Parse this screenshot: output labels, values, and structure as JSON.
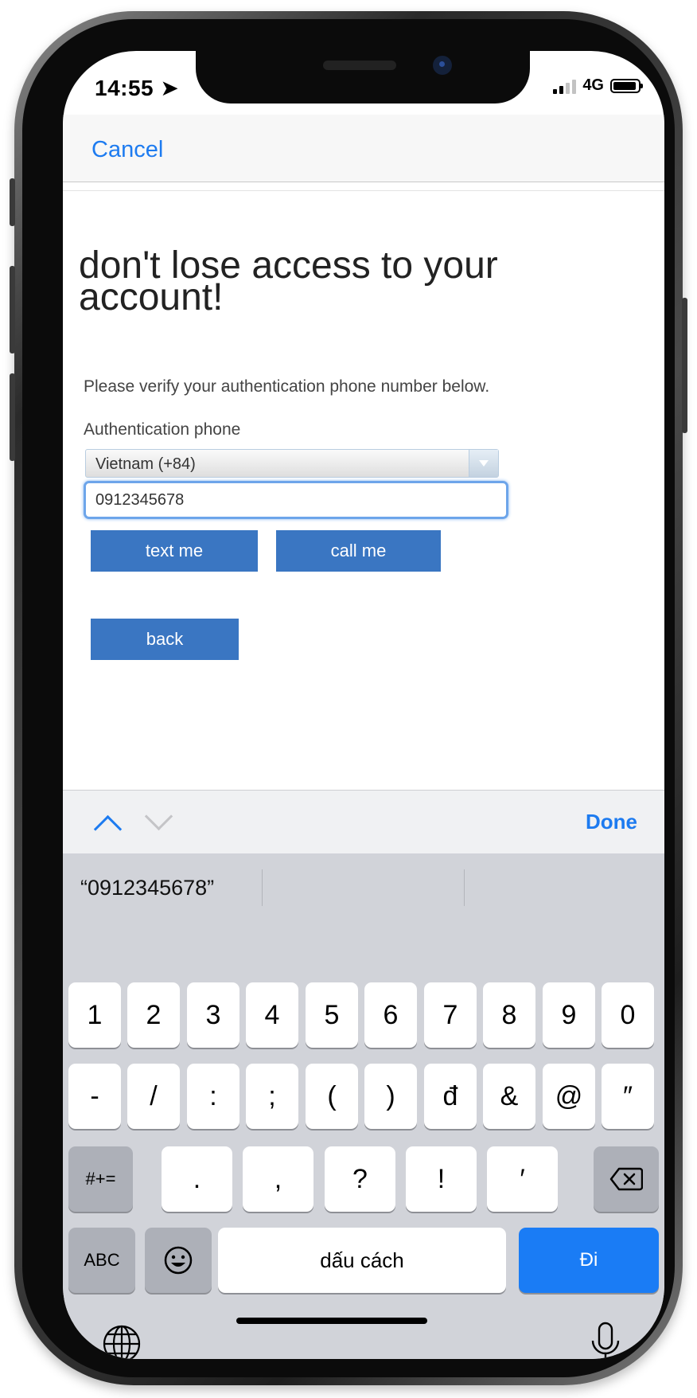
{
  "status_bar": {
    "time": "14:55",
    "network": "4G"
  },
  "nav": {
    "cancel_label": "Cancel"
  },
  "page": {
    "title": "don't lose access to your account!",
    "intro": "Please verify your authentication phone number below.",
    "phone_label": "Authentication phone",
    "country_value": "Vietnam (+84)",
    "phone_value": "0912345678",
    "text_me_label": "text me",
    "call_me_label": "call me",
    "back_label": "back"
  },
  "accessory": {
    "done_label": "Done"
  },
  "keyboard": {
    "suggestion": "“0912345678”",
    "row1": [
      "1",
      "2",
      "3",
      "4",
      "5",
      "6",
      "7",
      "8",
      "9",
      "0"
    ],
    "row2": [
      "-",
      "/",
      ":",
      ";",
      "(",
      ")",
      "đ",
      "&",
      "@",
      "″"
    ],
    "row3": [
      ".",
      ",",
      "?",
      "!",
      "′"
    ],
    "symbols_toggle": "#+=",
    "abc_label": "ABC",
    "space_label": "dấu cách",
    "go_label": "Đi"
  },
  "colors": {
    "accent": "#1d7bf0",
    "button_blue": "#3a76c2",
    "go_key": "#1a7cf5"
  }
}
